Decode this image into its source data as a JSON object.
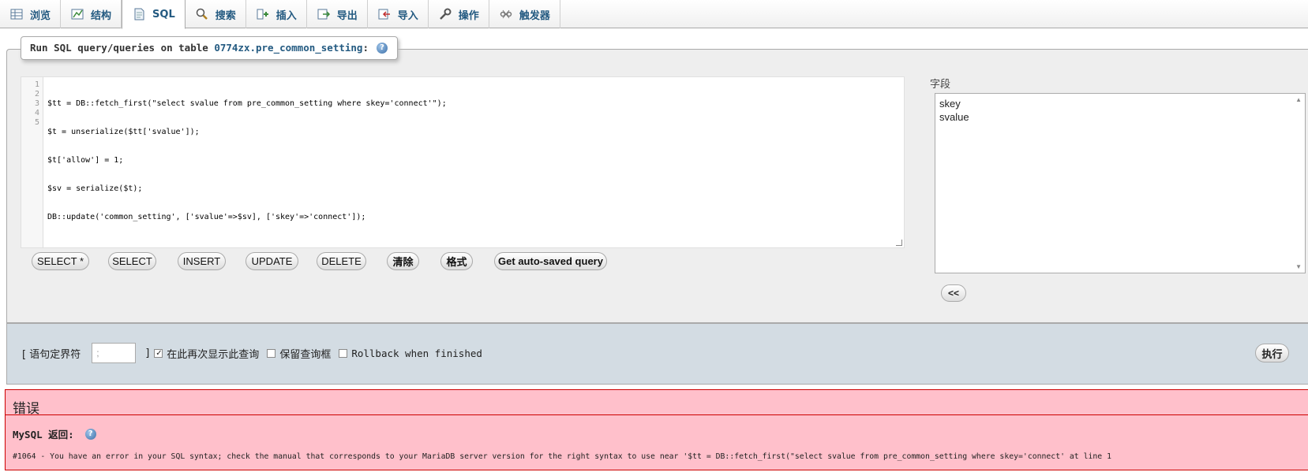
{
  "tabs": [
    {
      "label": "浏览",
      "icon": "browse-icon"
    },
    {
      "label": "结构",
      "icon": "structure-icon"
    },
    {
      "label": "SQL",
      "icon": "sql-icon",
      "active": true
    },
    {
      "label": "搜索",
      "icon": "search-icon"
    },
    {
      "label": "插入",
      "icon": "insert-icon"
    },
    {
      "label": "导出",
      "icon": "export-icon"
    },
    {
      "label": "导入",
      "icon": "import-icon"
    },
    {
      "label": "操作",
      "icon": "wrench-icon"
    },
    {
      "label": "触发器",
      "icon": "trigger-icon"
    }
  ],
  "legend": {
    "prefix": "Run SQL query/queries on table",
    "table": "0774zx.pre_common_setting",
    "suffix": ":"
  },
  "editor": {
    "line_numbers": [
      "1",
      "2",
      "3",
      "4",
      "5"
    ],
    "lines": [
      "$tt = DB::fetch_first(\"select svalue from pre_common_setting where skey='connect'\");",
      "$t = unserialize($tt['svalue']);",
      "$t['allow'] = 1;",
      "$sv = serialize($t);",
      "DB::update('common_setting', ['svalue'=>$sv], ['skey'=>'connect']);"
    ]
  },
  "query_buttons": {
    "select_all": "SELECT *",
    "select": "SELECT",
    "insert": "INSERT",
    "update": "UPDATE",
    "delete": "DELETE",
    "clear": "清除",
    "format": "格式",
    "autosaved": "Get auto-saved query"
  },
  "columns": {
    "label": "字段",
    "items": [
      "skey",
      "svalue"
    ],
    "insert_button": "<<"
  },
  "options": {
    "delimiter_open": "[ 语句定界符",
    "delimiter_value": ";",
    "delimiter_close": "]",
    "show_again": "在此再次显示此查询",
    "retain_box": "保留查询框",
    "rollback": "Rollback when finished",
    "go": "执行"
  },
  "error": {
    "title": "错误",
    "subtitle": "MySQL 返回:",
    "message": "#1064 - You have an error in your SQL syntax; check the manual that corresponds to your MariaDB server version for the right syntax to use near '$tt = DB::fetch_first(\"select svalue from pre_common_setting where skey='connect' at line 1"
  }
}
